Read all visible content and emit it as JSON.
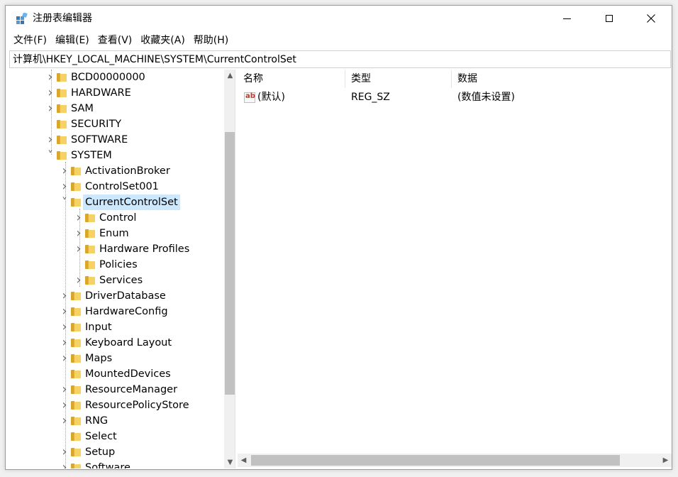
{
  "window": {
    "title": "注册表编辑器"
  },
  "menu": [
    "文件(F)",
    "编辑(E)",
    "查看(V)",
    "收藏夹(A)",
    "帮助(H)"
  ],
  "address": "计算机\\HKEY_LOCAL_MACHINE\\SYSTEM\\CurrentControlSet",
  "tree": [
    {
      "label": "BCD00000000",
      "level": 0,
      "expander": "collapsed"
    },
    {
      "label": "HARDWARE",
      "level": 0,
      "expander": "collapsed"
    },
    {
      "label": "SAM",
      "level": 0,
      "expander": "collapsed"
    },
    {
      "label": "SECURITY",
      "level": 0,
      "expander": "none"
    },
    {
      "label": "SOFTWARE",
      "level": 0,
      "expander": "collapsed"
    },
    {
      "label": "SYSTEM",
      "level": 0,
      "expander": "expanded"
    },
    {
      "label": "ActivationBroker",
      "level": 1,
      "expander": "collapsed"
    },
    {
      "label": "ControlSet001",
      "level": 1,
      "expander": "collapsed"
    },
    {
      "label": "CurrentControlSet",
      "level": 1,
      "expander": "expanded",
      "selected": true
    },
    {
      "label": "Control",
      "level": 2,
      "expander": "collapsed"
    },
    {
      "label": "Enum",
      "level": 2,
      "expander": "collapsed"
    },
    {
      "label": "Hardware Profiles",
      "level": 2,
      "expander": "collapsed"
    },
    {
      "label": "Policies",
      "level": 2,
      "expander": "none"
    },
    {
      "label": "Services",
      "level": 2,
      "expander": "collapsed"
    },
    {
      "label": "DriverDatabase",
      "level": 1,
      "expander": "collapsed"
    },
    {
      "label": "HardwareConfig",
      "level": 1,
      "expander": "collapsed"
    },
    {
      "label": "Input",
      "level": 1,
      "expander": "collapsed"
    },
    {
      "label": "Keyboard Layout",
      "level": 1,
      "expander": "collapsed"
    },
    {
      "label": "Maps",
      "level": 1,
      "expander": "collapsed"
    },
    {
      "label": "MountedDevices",
      "level": 1,
      "expander": "none"
    },
    {
      "label": "ResourceManager",
      "level": 1,
      "expander": "collapsed"
    },
    {
      "label": "ResourcePolicyStore",
      "level": 1,
      "expander": "collapsed"
    },
    {
      "label": "RNG",
      "level": 1,
      "expander": "collapsed"
    },
    {
      "label": "Select",
      "level": 1,
      "expander": "none"
    },
    {
      "label": "Setup",
      "level": 1,
      "expander": "collapsed"
    },
    {
      "label": "Software",
      "level": 1,
      "expander": "collapsed"
    }
  ],
  "list": {
    "columns": [
      "名称",
      "类型",
      "数据"
    ],
    "rows": [
      {
        "name": "(默认)",
        "type": "REG_SZ",
        "data": "(数值未设置)",
        "icon": "string-value-icon"
      }
    ]
  },
  "colors": {
    "selection": "#cce8ff",
    "folder": "#f6d265",
    "scroll_thumb": "#c1c1c1"
  }
}
